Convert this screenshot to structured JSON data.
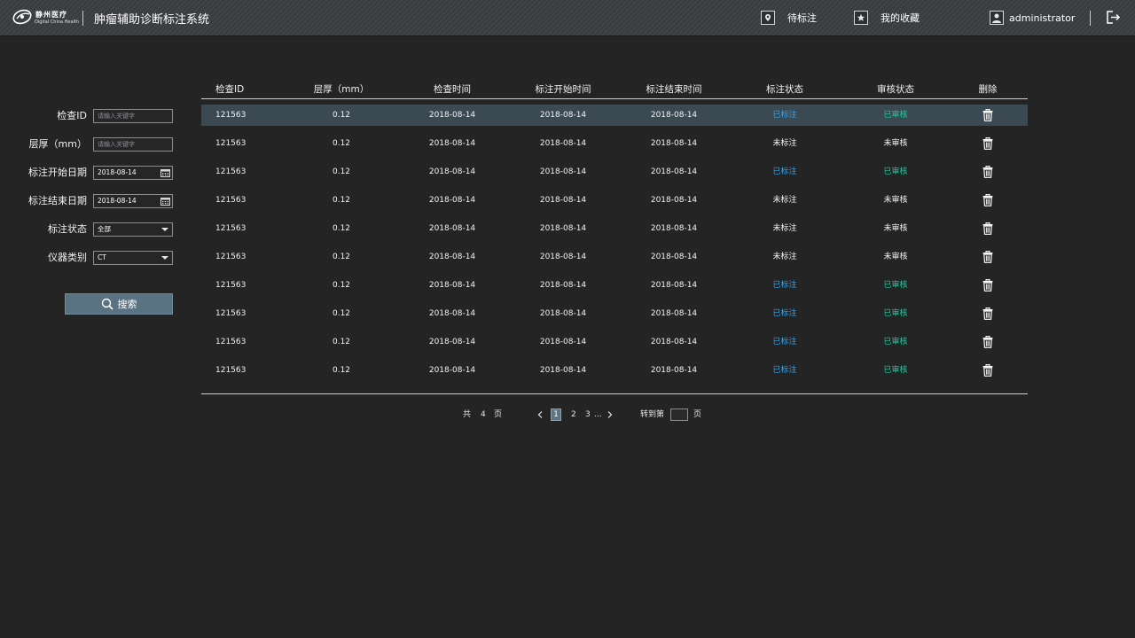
{
  "header": {
    "logo_main": "静州医疗",
    "logo_sub": "Digital China Health",
    "title": "肿瘤辅助诊断标注系统",
    "pending_label": "待标注",
    "favorites_label": "我的收藏",
    "username": "administrator",
    "icons": {
      "pending": "location-pin-icon",
      "favorites": "star-icon",
      "user": "user-icon",
      "logout": "logout-icon"
    }
  },
  "filters": {
    "exam_id": {
      "label": "检查ID",
      "placeholder": "请输入关键字"
    },
    "thickness": {
      "label": "层厚（mm）",
      "placeholder": "请输入关键字"
    },
    "start_date": {
      "label": "标注开始日期",
      "value": "2018-08-14"
    },
    "end_date": {
      "label": "标注结束日期",
      "value": "2018-08-14"
    },
    "status": {
      "label": "标注状态",
      "value": "全部"
    },
    "device": {
      "label": "仪器类别",
      "value": "CT"
    },
    "search_label": "搜索"
  },
  "table": {
    "columns": [
      "检查ID",
      "层厚（mm）",
      "检查时间",
      "标注开始时间",
      "标注结束时间",
      "标注状态",
      "审核状态",
      "删除"
    ],
    "rows": [
      {
        "id": "121563",
        "thickness": "0.12",
        "exam_time": "2018-08-14",
        "start": "2018-08-14",
        "end": "2018-08-14",
        "annot": "已标注",
        "review": "已审核"
      },
      {
        "id": "121563",
        "thickness": "0.12",
        "exam_time": "2018-08-14",
        "start": "2018-08-14",
        "end": "2018-08-14",
        "annot": "未标注",
        "review": "未审核"
      },
      {
        "id": "121563",
        "thickness": "0.12",
        "exam_time": "2018-08-14",
        "start": "2018-08-14",
        "end": "2018-08-14",
        "annot": "已标注",
        "review": "已审核"
      },
      {
        "id": "121563",
        "thickness": "0.12",
        "exam_time": "2018-08-14",
        "start": "2018-08-14",
        "end": "2018-08-14",
        "annot": "未标注",
        "review": "未审核"
      },
      {
        "id": "121563",
        "thickness": "0.12",
        "exam_time": "2018-08-14",
        "start": "2018-08-14",
        "end": "2018-08-14",
        "annot": "未标注",
        "review": "未审核"
      },
      {
        "id": "121563",
        "thickness": "0.12",
        "exam_time": "2018-08-14",
        "start": "2018-08-14",
        "end": "2018-08-14",
        "annot": "未标注",
        "review": "未审核"
      },
      {
        "id": "121563",
        "thickness": "0.12",
        "exam_time": "2018-08-14",
        "start": "2018-08-14",
        "end": "2018-08-14",
        "annot": "已标注",
        "review": "已审核"
      },
      {
        "id": "121563",
        "thickness": "0.12",
        "exam_time": "2018-08-14",
        "start": "2018-08-14",
        "end": "2018-08-14",
        "annot": "已标注",
        "review": "已审核"
      },
      {
        "id": "121563",
        "thickness": "0.12",
        "exam_time": "2018-08-14",
        "start": "2018-08-14",
        "end": "2018-08-14",
        "annot": "已标注",
        "review": "已审核"
      },
      {
        "id": "121563",
        "thickness": "0.12",
        "exam_time": "2018-08-14",
        "start": "2018-08-14",
        "end": "2018-08-14",
        "annot": "已标注",
        "review": "已审核"
      }
    ],
    "selected_row": 0,
    "delete_icon": "trash-icon"
  },
  "pagination": {
    "total_prefix": "共",
    "total_pages": "4",
    "total_suffix": "页",
    "pages": [
      "1",
      "2",
      "3"
    ],
    "ellipsis": "...",
    "current_page": "1",
    "jump_label": "转到第",
    "jump_suffix": "页"
  },
  "colors": {
    "background": "#242424",
    "header": "#3a3d40",
    "accent": "#5a7383",
    "annotated": "#3aa3ea",
    "reviewed": "#27c6a0"
  }
}
